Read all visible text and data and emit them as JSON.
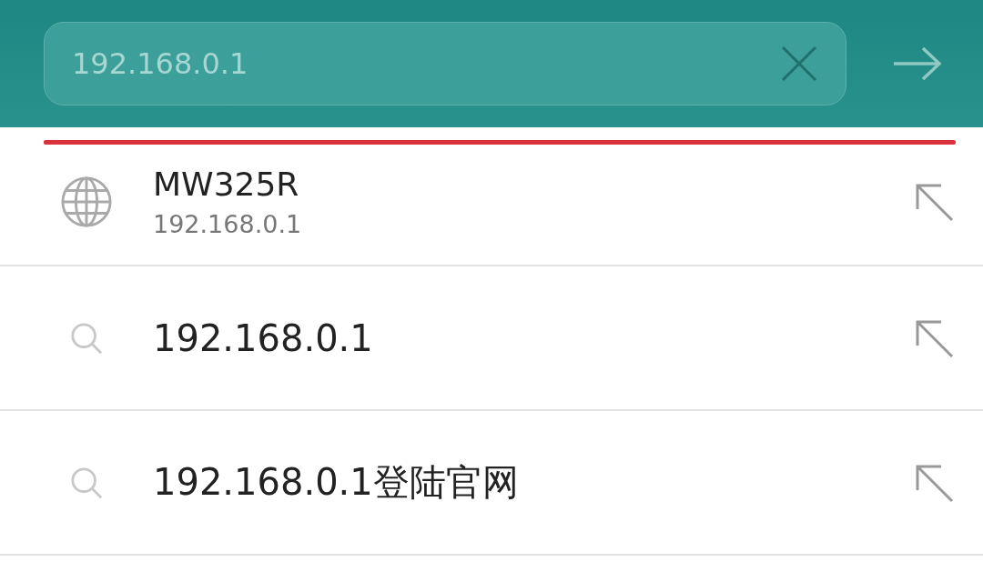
{
  "search_bar": {
    "value": "192.168.0.1"
  },
  "suggestions": [
    {
      "kind": "site",
      "title": "MW325R",
      "url": "192.168.0.1"
    },
    {
      "kind": "query",
      "text": "192.168.0.1"
    },
    {
      "kind": "query",
      "text": "192.168.0.1登陆官网"
    }
  ]
}
